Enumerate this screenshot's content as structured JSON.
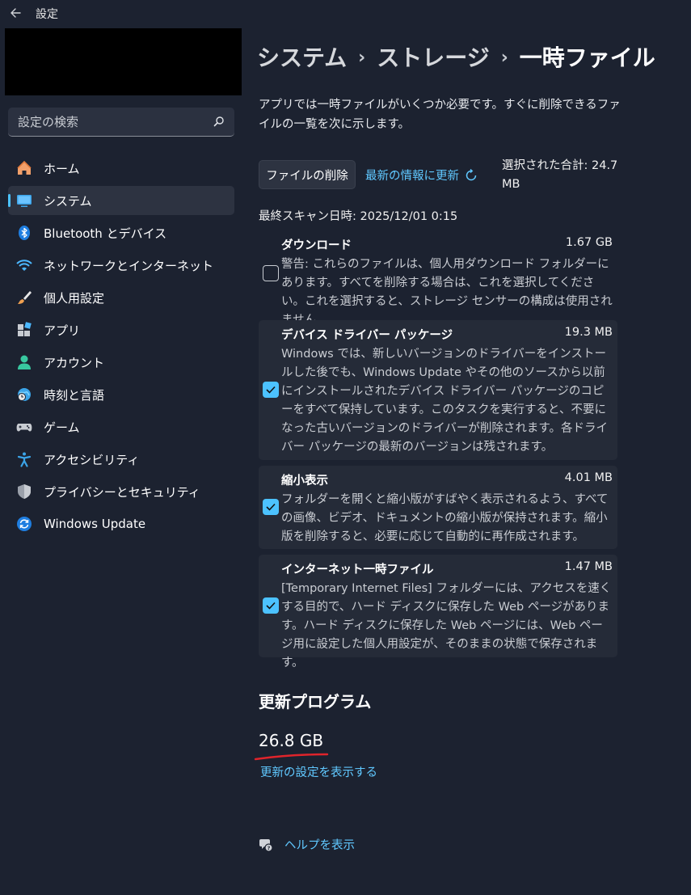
{
  "window": {
    "title": "設定"
  },
  "search": {
    "placeholder": "設定の検索"
  },
  "sidebar": {
    "items": [
      {
        "label": "ホーム",
        "icon": "home-icon"
      },
      {
        "label": "システム",
        "icon": "monitor-icon",
        "active": true
      },
      {
        "label": "Bluetooth とデバイス",
        "icon": "bluetooth-icon"
      },
      {
        "label": "ネットワークとインターネット",
        "icon": "wifi-icon"
      },
      {
        "label": "個人用設定",
        "icon": "brush-icon"
      },
      {
        "label": "アプリ",
        "icon": "apps-icon"
      },
      {
        "label": "アカウント",
        "icon": "person-icon"
      },
      {
        "label": "時刻と言語",
        "icon": "globe-clock-icon"
      },
      {
        "label": "ゲーム",
        "icon": "gamepad-icon"
      },
      {
        "label": "アクセシビリティ",
        "icon": "accessibility-icon"
      },
      {
        "label": "プライバシーとセキュリティ",
        "icon": "shield-icon"
      },
      {
        "label": "Windows Update",
        "icon": "sync-icon"
      }
    ]
  },
  "breadcrumb": {
    "part1": "システム",
    "part2": "ストレージ",
    "current": "一時ファイル",
    "sep": "›"
  },
  "main": {
    "description": "アプリでは一時ファイルがいくつか必要です。すぐに削除できるファイルの一覧を次に示します。",
    "delete_button": "ファイルの削除",
    "refresh_link": "最新の情報に更新",
    "selected_total": "選択された合計: 24.7 MB",
    "last_scan": "最終スキャン日時: 2025/12/01 0:15",
    "items": [
      {
        "name": "ダウンロード",
        "size": "1.67 GB",
        "checked": false,
        "description": "警告: これらのファイルは、個人用ダウンロード フォルダーにあります。すべてを削除する場合は、これを選択してください。これを選択すると、ストレージ センサーの構成は使用されません。"
      },
      {
        "name": "デバイス ドライバー パッケージ",
        "size": "19.3 MB",
        "checked": true,
        "description": "Windows では、新しいバージョンのドライバーをインストールした後でも、Windows Update やその他のソースから以前にインストールされたデバイス ドライバー パッケージのコピーをすべて保持しています。このタスクを実行すると、不要になった古いバージョンのドライバーが削除されます。各ドライバー パッケージの最新のバージョンは残されます。"
      },
      {
        "name": "縮小表示",
        "size": "4.01 MB",
        "checked": true,
        "description": "フォルダーを開くと縮小版がすばやく表示されるよう、すべての画像、ビデオ、ドキュメントの縮小版が保持されます。縮小版を削除すると、必要に応じて自動的に再作成されます。"
      },
      {
        "name": "インターネット一時ファイル",
        "size": "1.47 MB",
        "checked": true,
        "description": "[Temporary Internet Files] フォルダーには、アクセスを速くする目的で、ハード ディスクに保存した Web ページがあります。ハード ディスクに保存した Web ページには、Web ページ用に設定した個人用設定が、そのままの状態で保存されます。"
      }
    ],
    "updates_heading": "更新プログラム",
    "updates_size": "26.8 GB",
    "updates_link": "更新の設定を表示する",
    "help_link": "ヘルプを表示"
  },
  "colors": {
    "accent": "#4cc2ff",
    "link": "#60c8ff",
    "background": "#1c2230",
    "annotation": "#e0242b"
  }
}
